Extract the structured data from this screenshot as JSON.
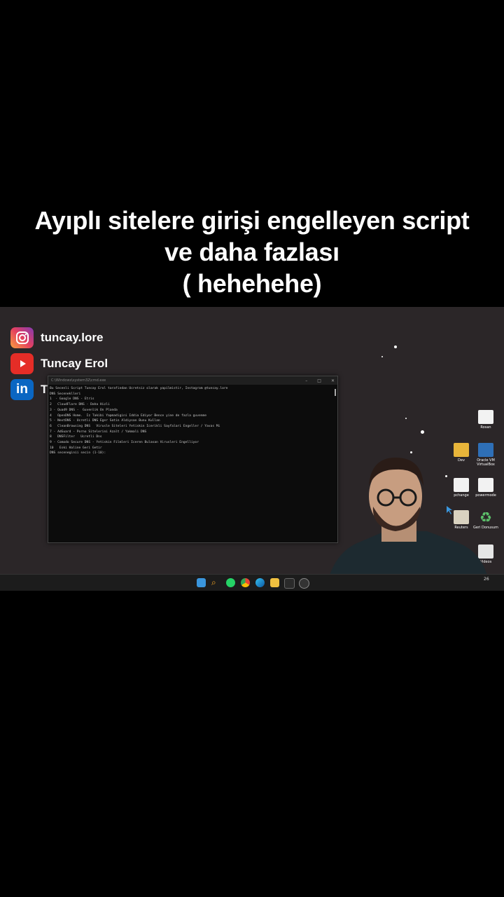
{
  "caption": {
    "line1": "Ayıplı sitelere girişi engelleyen script",
    "line2": "ve daha fazlası",
    "line3": "( hehehehe)"
  },
  "social": {
    "instagram": "tuncay.lore",
    "youtube": "Tuncay Erol",
    "linkedin": "T"
  },
  "cmd": {
    "title": "C:\\Windows\\system32\\cmd.exe",
    "lines": [
      "Bu Secenli Script Tuncay Erol tarafindan Ucretsiz olarak yapilmistir, Instagram @tuncay.lore",
      "DNS Seceneklleri",
      "1  - Google DNS - Etris",
      "2   CloudFlare DNS - Daha Hizli",
      "3 - Quad9 DNS -  Guvenlik On Planda",
      "4   OpenDNS Home.  Iz Takibi Yapmadigini Iddia Ediyor Bence yine de fazla guvenme",
      "5 - NextDNS - Ucretli DNS Eger Satin Aldiysan Bunu Kullan",
      "6   CleanBrowsing DNS   Virusle Siteleri Yetiskin Icerikli Sayfalari Engeller / Yavas Mi",
      "7 - AdGuard - Porno Sitelerini Azalt / Yakmali DNS",
      "8   DNSFilter   Ucretli Dns",
      "9 - Comodo Secure DNS - Yetiskin Filmleri Iceren Bulasan Virusleri Engelliyor",
      "10   Eski Haline Geri Getir",
      "DNS seceneginii secin (1-10):"
    ]
  },
  "desktop": {
    "icons": [
      "Rosan",
      "Dev",
      "Oracle VM VirtualBox",
      "pchange",
      "powermode",
      "Reuters",
      "Geri Donusum",
      "Videos"
    ]
  },
  "taskbar": {
    "time": "26"
  },
  "colors": {
    "screen_bg": "#2b2628",
    "taskbar_bg": "#1c1c1c",
    "windows_blue": "#3a96dd"
  }
}
